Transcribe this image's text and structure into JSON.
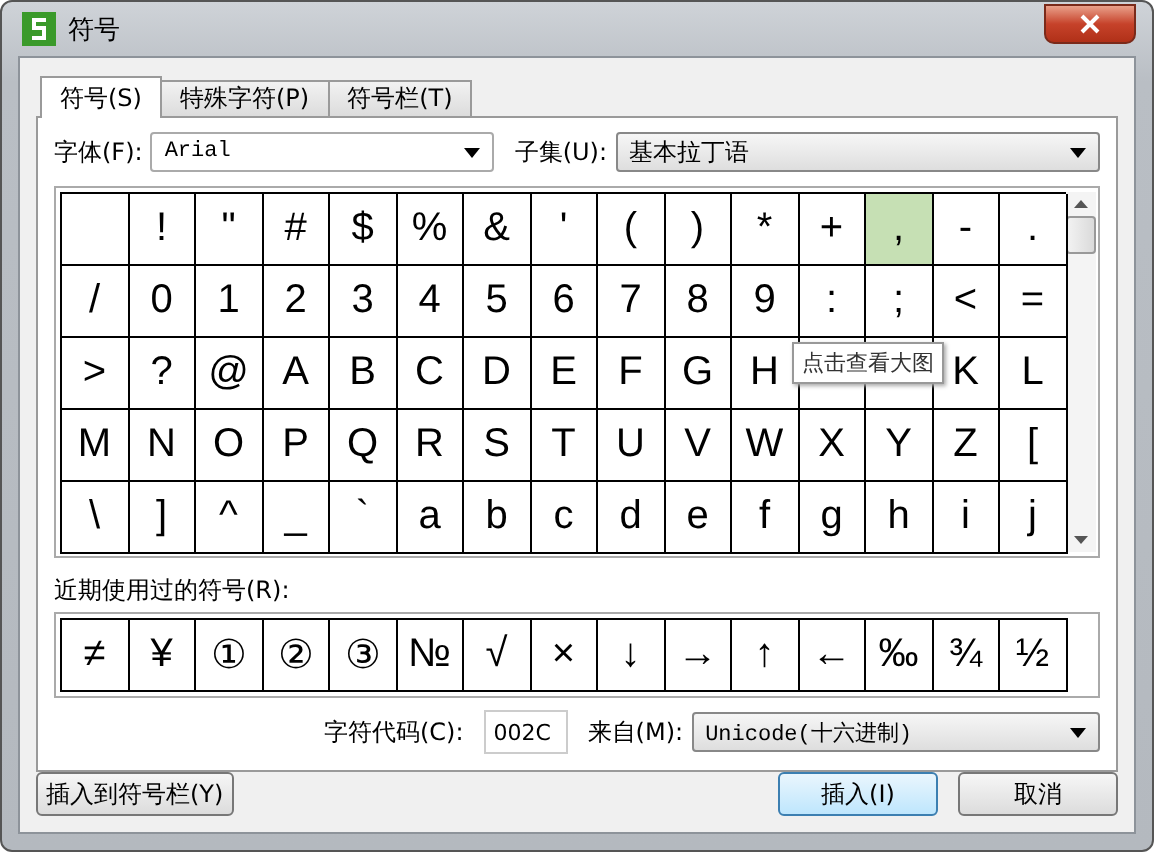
{
  "window": {
    "title": "符号"
  },
  "tabs": [
    {
      "label": "符号(S)",
      "selected": true
    },
    {
      "label": "特殊字符(P)",
      "selected": false
    },
    {
      "label": "符号栏(T)",
      "selected": false
    }
  ],
  "font": {
    "label": "字体(F):",
    "value": "Arial"
  },
  "subset": {
    "label": "子集(U):",
    "value": "基本拉丁语"
  },
  "grid": {
    "rows": [
      [
        {
          "selected": false
        },
        {
          "char": "!",
          "selected": false
        },
        {
          "char": "\"",
          "selected": false
        },
        {
          "char": "#",
          "selected": false
        },
        {
          "char": "$",
          "selected": false
        },
        {
          "char": "%",
          "selected": false
        },
        {
          "char": "&",
          "selected": false
        },
        {
          "char": "'",
          "selected": false
        },
        {
          "char": "(",
          "selected": false
        },
        {
          "char": ")",
          "selected": false
        },
        {
          "char": "*",
          "selected": false
        },
        {
          "char": "+",
          "selected": false
        },
        {
          "char": ",",
          "selected": true
        },
        {
          "char": "-",
          "selected": false
        },
        {
          "char": ".",
          "selected": false
        }
      ],
      [
        {
          "char": "/",
          "selected": false
        },
        {
          "char": "0",
          "selected": false
        },
        {
          "char": "1",
          "selected": false
        },
        {
          "char": "2",
          "selected": false
        },
        {
          "char": "3",
          "selected": false
        },
        {
          "char": "4",
          "selected": false
        },
        {
          "char": "5",
          "selected": false
        },
        {
          "char": "6",
          "selected": false
        },
        {
          "char": "7",
          "selected": false
        },
        {
          "char": "8",
          "selected": false
        },
        {
          "char": "9",
          "selected": false
        },
        {
          "char": ":",
          "selected": false
        },
        {
          "char": ";",
          "selected": false
        },
        {
          "char": "<",
          "selected": false
        },
        {
          "char": "=",
          "selected": false
        }
      ],
      [
        {
          "char": ">",
          "selected": false
        },
        {
          "char": "?",
          "selected": false
        },
        {
          "char": "@",
          "selected": false
        },
        {
          "char": "A",
          "selected": false
        },
        {
          "char": "B",
          "selected": false
        },
        {
          "char": "C",
          "selected": false
        },
        {
          "char": "D",
          "selected": false
        },
        {
          "char": "E",
          "selected": false
        },
        {
          "char": "F",
          "selected": false
        },
        {
          "char": "G",
          "selected": false
        },
        {
          "char": "H",
          "selected": false
        },
        {
          "selected": false
        },
        {
          "selected": false
        },
        {
          "char": "K",
          "selected": false
        },
        {
          "char": "L",
          "selected": false
        }
      ],
      [
        {
          "char": "M",
          "selected": false
        },
        {
          "char": "N",
          "selected": false
        },
        {
          "char": "O",
          "selected": false
        },
        {
          "char": "P",
          "selected": false
        },
        {
          "char": "Q",
          "selected": false
        },
        {
          "char": "R",
          "selected": false
        },
        {
          "char": "S",
          "selected": false
        },
        {
          "char": "T",
          "selected": false
        },
        {
          "char": "U",
          "selected": false
        },
        {
          "char": "V",
          "selected": false
        },
        {
          "char": "W",
          "selected": false
        },
        {
          "char": "X",
          "selected": false
        },
        {
          "char": "Y",
          "selected": false
        },
        {
          "char": "Z",
          "selected": false
        },
        {
          "char": "[",
          "selected": false
        }
      ],
      [
        {
          "char": "\\",
          "selected": false
        },
        {
          "char": "]",
          "selected": false
        },
        {
          "char": "^",
          "selected": false
        },
        {
          "char": "_",
          "selected": false
        },
        {
          "char": "`",
          "selected": false
        },
        {
          "char": "a",
          "selected": false
        },
        {
          "char": "b",
          "selected": false
        },
        {
          "char": "c",
          "selected": false
        },
        {
          "char": "d",
          "selected": false
        },
        {
          "char": "e",
          "selected": false
        },
        {
          "char": "f",
          "selected": false
        },
        {
          "char": "g",
          "selected": false
        },
        {
          "char": "h",
          "selected": false
        },
        {
          "char": "i",
          "selected": false
        },
        {
          "char": "j",
          "selected": false
        }
      ]
    ],
    "tooltip": "点击查看大图"
  },
  "recent": {
    "label": "近期使用过的符号(R):",
    "symbols": [
      "≠",
      "¥",
      "①",
      "②",
      "③",
      "№",
      "√",
      "×",
      "↓",
      "→",
      "↑",
      "←",
      "‰",
      "¾",
      "½"
    ]
  },
  "code": {
    "label": "字符代码(C):",
    "value": "002C",
    "from_label": "来自(M):",
    "from_value": "Unicode(十六进制)"
  },
  "buttons": {
    "add_to_bar": "插入到符号栏(Y)",
    "insert": "插入(I)",
    "cancel": "取消"
  }
}
